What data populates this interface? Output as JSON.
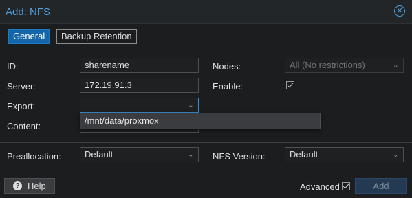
{
  "window": {
    "title": "Add: NFS"
  },
  "tabs": [
    {
      "label": "General"
    },
    {
      "label": "Backup Retention"
    }
  ],
  "form": {
    "id_label": "ID:",
    "id_value": "sharename",
    "server_label": "Server:",
    "server_value": "172.19.91.3",
    "export_label": "Export:",
    "export_value": "",
    "content_label": "Content:",
    "nodes_label": "Nodes:",
    "nodes_value": "All (No restrictions)",
    "enable_label": "Enable:",
    "enable_checked": true,
    "preallocation_label": "Preallocation:",
    "preallocation_value": "Default",
    "nfs_version_label": "NFS Version:",
    "nfs_version_value": "Default"
  },
  "export_dropdown": {
    "options": [
      "/mnt/data/proxmox"
    ]
  },
  "footer": {
    "help_label": "Help",
    "advanced_label": "Advanced",
    "advanced_checked": true,
    "add_label": "Add"
  },
  "colors": {
    "accent": "#4fa3e0",
    "active_tab": "#1566a8",
    "background": "#1c1d1f"
  }
}
